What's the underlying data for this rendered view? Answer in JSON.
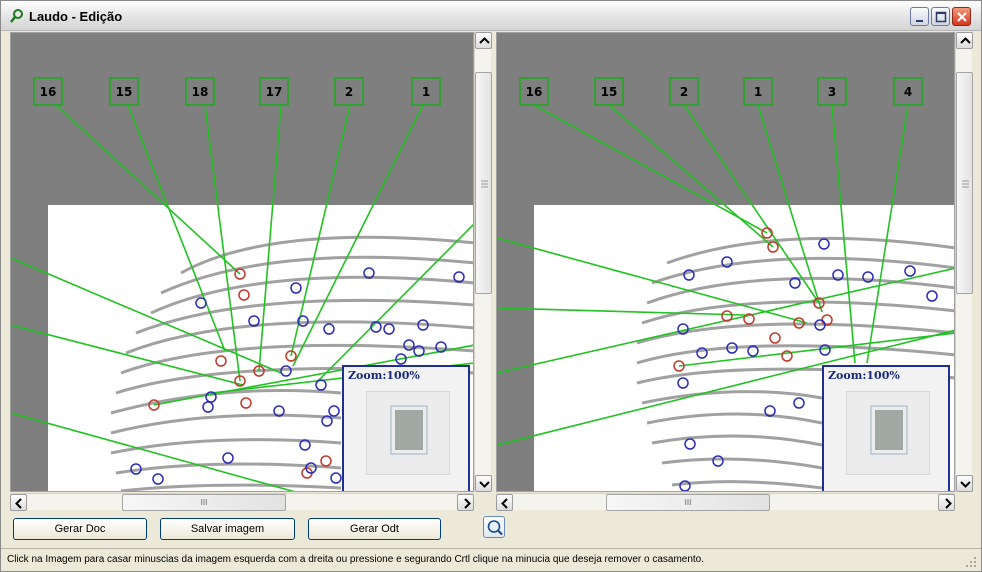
{
  "window": {
    "title": "Laudo - Edição"
  },
  "panes": {
    "left": {
      "labels": [
        "16",
        "15",
        "18",
        "17",
        "2",
        "1"
      ],
      "zoom_label": "Zoom:100%"
    },
    "right": {
      "labels": [
        "16",
        "15",
        "2",
        "1",
        "3",
        "4"
      ],
      "zoom_label": "Zoom:100%"
    }
  },
  "scrollbars": {
    "left_h_grip": "III",
    "right_h_grip": "III"
  },
  "buttons": {
    "gerar_doc": "Gerar Doc",
    "salvar_imagem": "Salvar imagem",
    "gerar_odt": "Gerar Odt"
  },
  "status": "Click na Imagem para casar minuscias da imagem esquerda com a dreita ou pressione e segurando Crtl clique na minucia que deseja remover o casamento.",
  "colors": {
    "label_border": "#1ea81e",
    "match_line": "#22c222",
    "matched_minutia": "#c0392b",
    "unmatched_minutia": "#2b2bb8",
    "zoom_border": "#1f2f8f"
  }
}
